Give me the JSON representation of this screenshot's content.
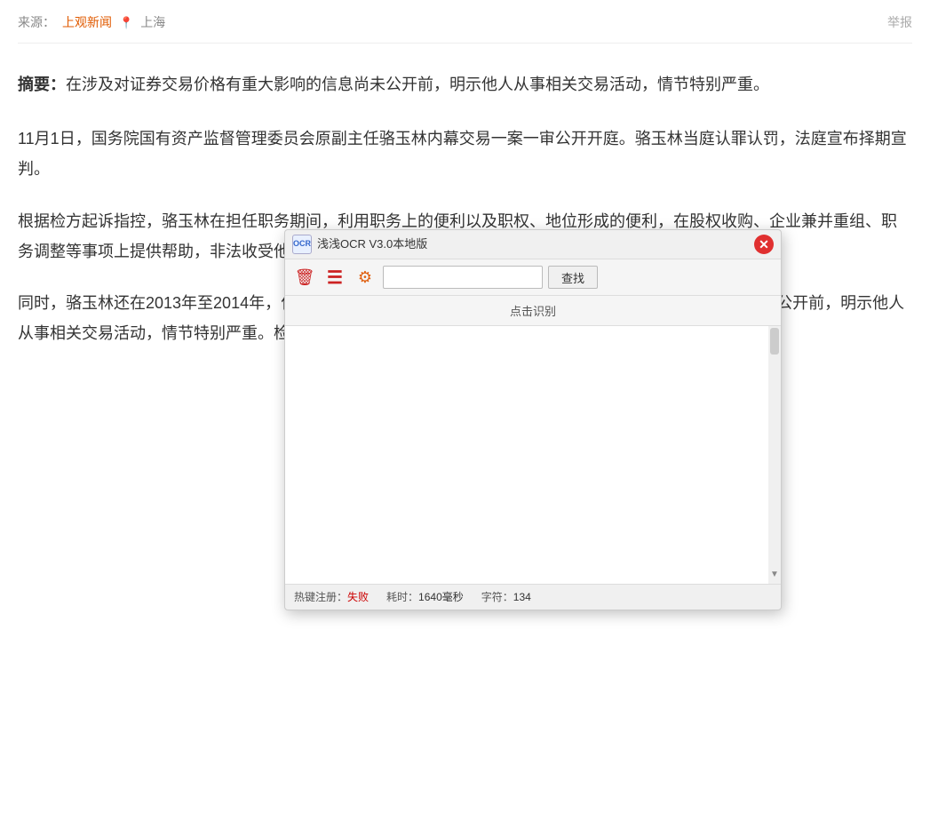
{
  "meta": {
    "source_label": "来源：",
    "source_name": "上观新闻",
    "location_icon": "📍",
    "location": "上海",
    "report_text": "举报"
  },
  "article": {
    "summary_label": "摘要：",
    "summary_text": "在涉及对证券交易价格有重大影响的信息尚未公开前，明示他人从事相关交易活动，情节特别严重。",
    "paragraph1": "11月1日，国务院国有资产监督管理委员会原副主任骆玉林内幕交易一案一审公开开庭。骆玉林当庭认罪认罚，法庭宣布择期宣判。",
    "paragraph2": "根据检方起诉指控，骆玉林在担任职务期间，利用职务上的便利以及职权、地位形成的便利，在股权收购、企业兼并重组、职务调整等事项上提供帮助，非法收受他人财物。",
    "paragraph3": "同时，骆玉林还在2013年至2014年，作为内幕信息的知情人，在涉及对证券交易价格有重大影响的信息尚未公开前，明示他人从事相关交易活动，情节特别严重。检察机关提请以受贿罪、内幕交易罪追究骆玉林的刑事责任。"
  },
  "ocr_dialog": {
    "title": "浅浅OCR V3.0本地版",
    "logo_text": "OCR",
    "close_btn_symbol": "✕",
    "trash_icon": "🗑",
    "list_icon": "≡",
    "gear_icon": "⚙",
    "search_placeholder": "",
    "find_btn_label": "查找",
    "recognize_btn_label": "点击识别",
    "status_hotkey_label": "热键注册：",
    "status_hotkey_value": "失败",
    "status_time_label": "耗时：",
    "status_time_value": "1640毫秒",
    "status_chars_label": "字符：",
    "status_chars_value": "134"
  }
}
